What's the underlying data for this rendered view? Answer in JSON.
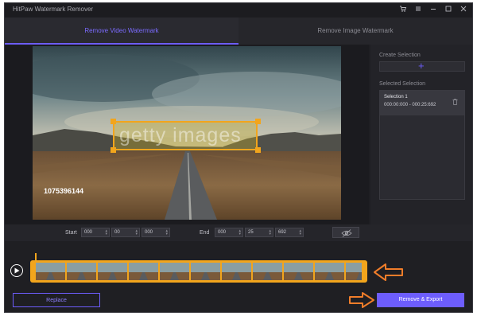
{
  "app": {
    "title": "HitPaw Watermark Remover"
  },
  "window_controls": [
    "cart-icon",
    "menu-icon",
    "minimize-icon",
    "maximize-icon",
    "close-icon"
  ],
  "tabs": [
    {
      "label": "Remove Video Watermark",
      "active": true
    },
    {
      "label": "Remove Image Watermark",
      "active": false
    }
  ],
  "video": {
    "watermark_text": "getty images",
    "overlay_number": "1075396144"
  },
  "side": {
    "create_label": "Create Selection",
    "selected_label": "Selected Selection",
    "selections": [
      {
        "name": "Selection 1",
        "time": "000:00:000 - 000:25:692"
      }
    ]
  },
  "controls": {
    "start_label": "Start",
    "start": [
      "000",
      "00",
      "000"
    ],
    "end_label": "End",
    "end": [
      "000",
      "25",
      "692"
    ]
  },
  "buttons": {
    "replace": "Replace",
    "export": "Remove & Export"
  },
  "colors": {
    "accent": "#6d5dfc",
    "selection": "#f2a51c",
    "arrow": "#f07d2a",
    "background": "#1f1f23"
  }
}
